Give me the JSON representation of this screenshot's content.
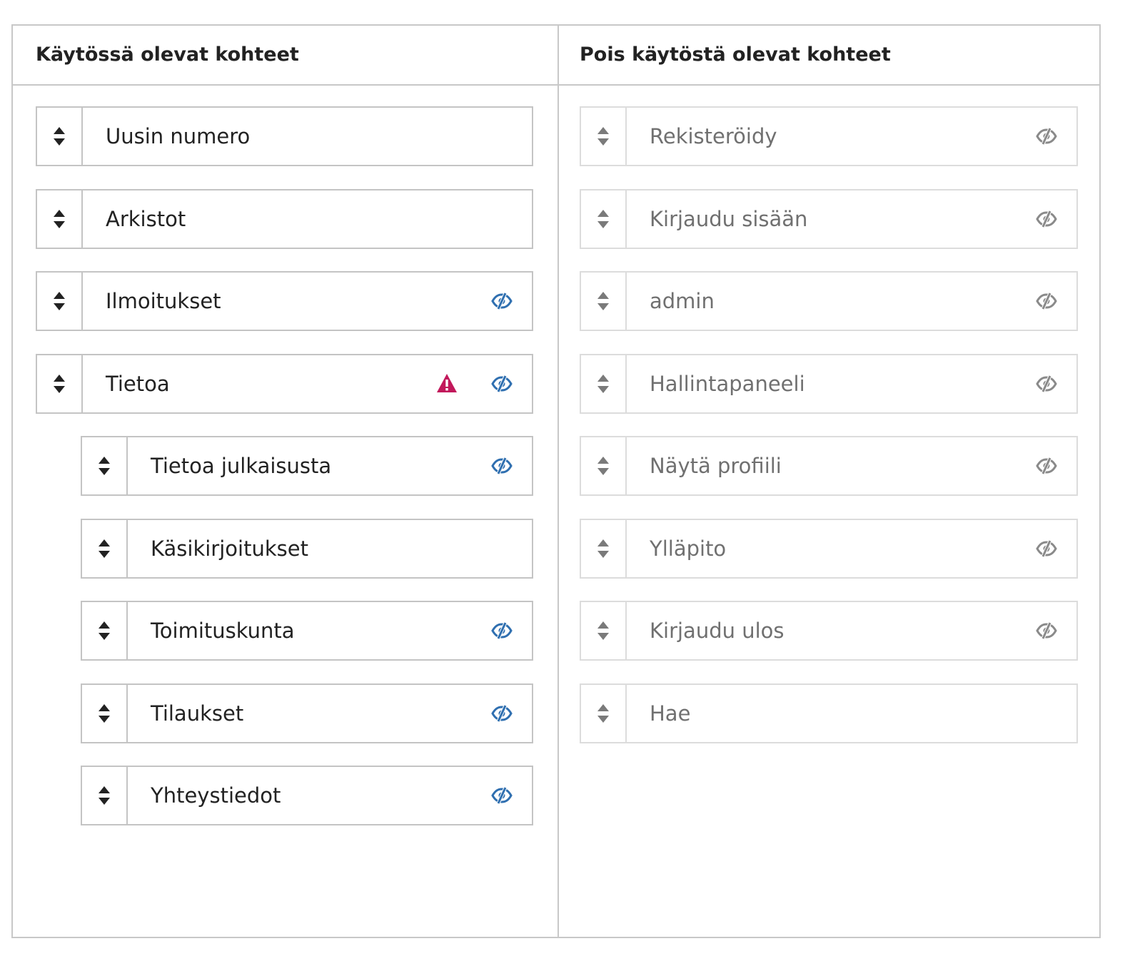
{
  "columns": {
    "enabled_title": "Käytössä olevat kohteet",
    "disabled_title": "Pois käytöstä olevat kohteet"
  },
  "colors": {
    "eye_enabled": "#2f6fb0",
    "eye_disabled": "#8a8a8a",
    "warning": "#c2185b"
  },
  "enabled_items": [
    {
      "label": "Uusin numero",
      "indent": 0,
      "eye": false,
      "warning": false
    },
    {
      "label": "Arkistot",
      "indent": 0,
      "eye": false,
      "warning": false
    },
    {
      "label": "Ilmoitukset",
      "indent": 0,
      "eye": true,
      "warning": false
    },
    {
      "label": "Tietoa",
      "indent": 0,
      "eye": true,
      "warning": true
    },
    {
      "label": "Tietoa julkaisusta",
      "indent": 1,
      "eye": true,
      "warning": false
    },
    {
      "label": "Käsikirjoitukset",
      "indent": 1,
      "eye": false,
      "warning": false
    },
    {
      "label": "Toimituskunta",
      "indent": 1,
      "eye": true,
      "warning": false
    },
    {
      "label": "Tilaukset",
      "indent": 1,
      "eye": true,
      "warning": false
    },
    {
      "label": "Yhteystiedot",
      "indent": 1,
      "eye": true,
      "warning": false
    }
  ],
  "disabled_items": [
    {
      "label": "Rekisteröidy",
      "eye": true
    },
    {
      "label": "Kirjaudu sisään",
      "eye": true
    },
    {
      "label": "admin",
      "eye": true
    },
    {
      "label": "Hallintapaneeli",
      "eye": true
    },
    {
      "label": "Näytä profiili",
      "eye": true
    },
    {
      "label": "Ylläpito",
      "eye": true
    },
    {
      "label": "Kirjaudu ulos",
      "eye": true
    },
    {
      "label": "Hae",
      "eye": false
    }
  ]
}
